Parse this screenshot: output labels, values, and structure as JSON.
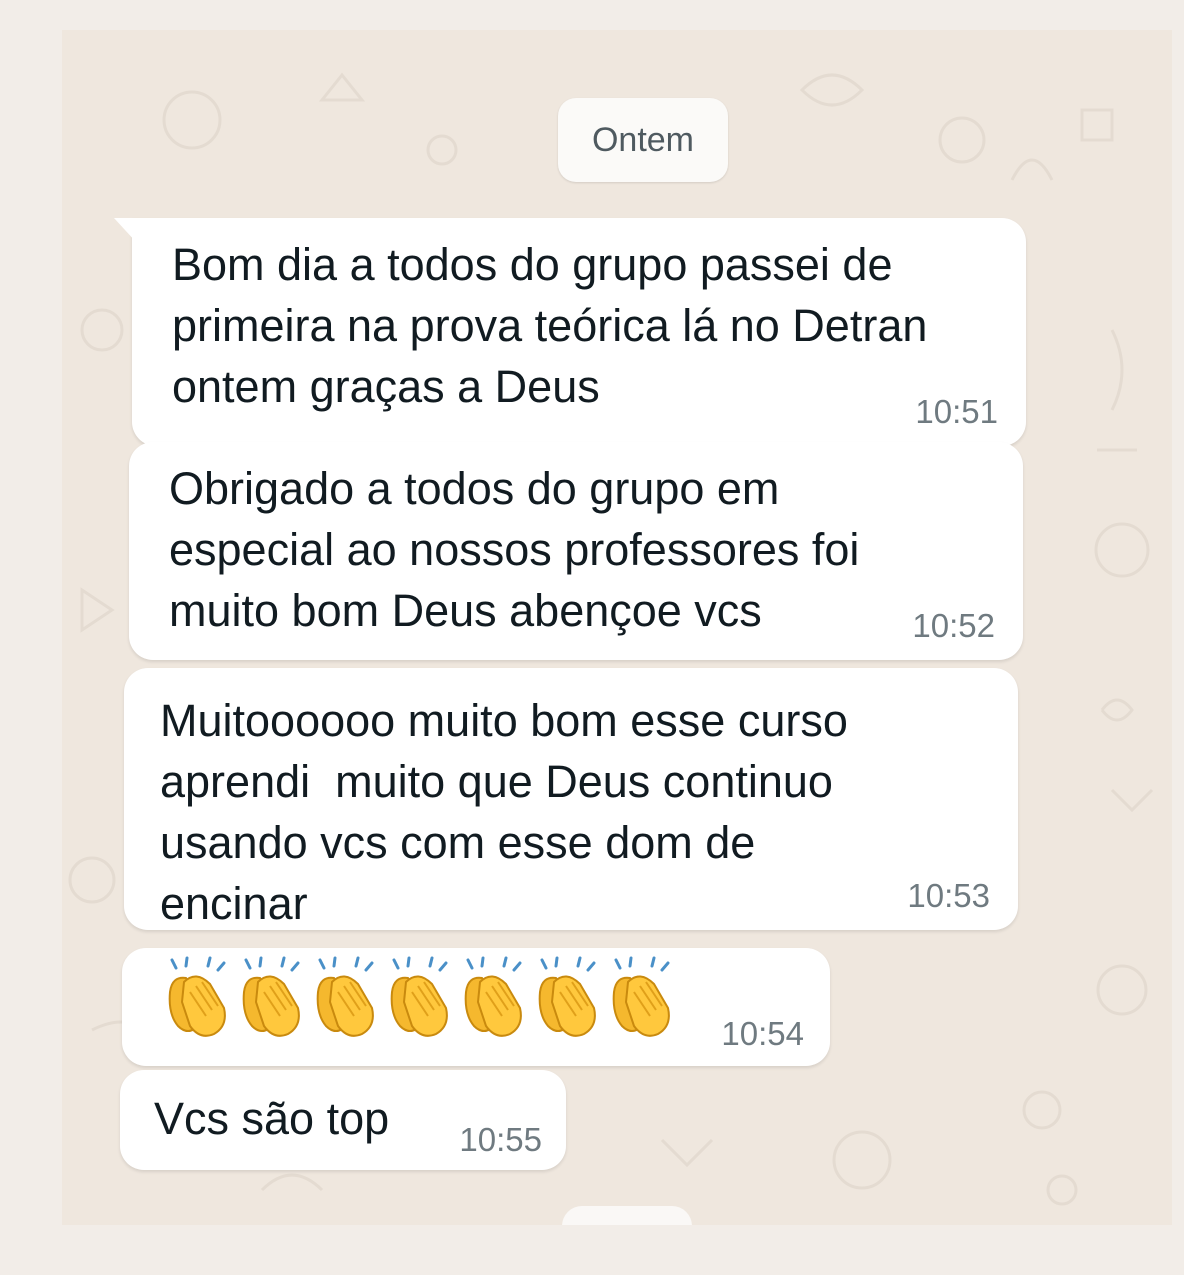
{
  "date_label": "Ontem",
  "messages": [
    {
      "text": "Bom dia a todos do grupo passei de\nprimeira na prova teórica lá no Detran\nontem graças a Deus",
      "time": "10:51"
    },
    {
      "text": "Obrigado a todos do grupo em\nespecial ao nossos professores foi\nmuito bom Deus abençoe vcs",
      "time": "10:52"
    },
    {
      "text": "Muitoooooo muito bom esse curso\naprendi  muito que Deus continuo\nusando vcs com esse dom de\nencinar",
      "time": "10:53"
    },
    {
      "emoji_count": 7,
      "emoji_icon": "clapping-hands-icon",
      "time": "10:54"
    },
    {
      "text": "Vcs são top",
      "time": "10:55"
    }
  ],
  "colors": {
    "page_bg": "#f2ede8",
    "chat_bg": "#efe7de",
    "bubble_bg": "#ffffff",
    "text": "#111b21",
    "time_text": "#6f7a80"
  }
}
